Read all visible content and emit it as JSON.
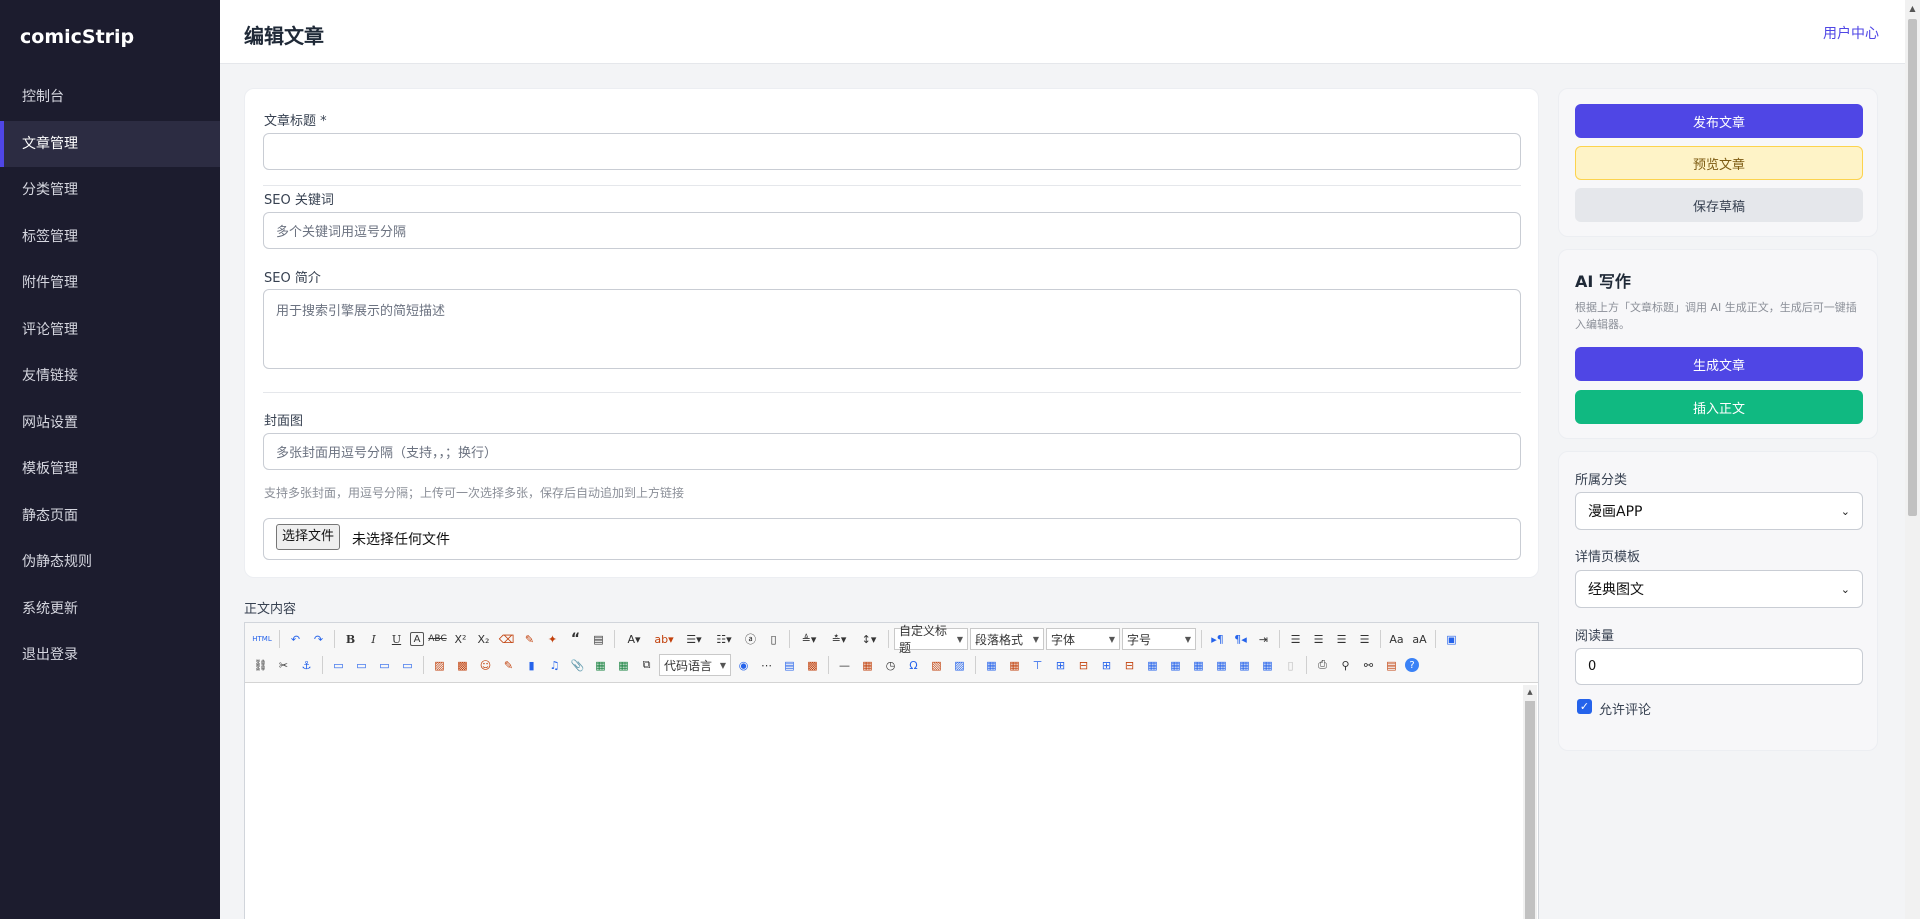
{
  "app": {
    "brand": "comicStrip"
  },
  "sidebar": {
    "items": [
      {
        "label": "控制台"
      },
      {
        "label": "文章管理",
        "active": true
      },
      {
        "label": "分类管理"
      },
      {
        "label": "标签管理"
      },
      {
        "label": "附件管理"
      },
      {
        "label": "评论管理"
      },
      {
        "label": "友情链接"
      },
      {
        "label": "网站设置"
      },
      {
        "label": "模板管理"
      },
      {
        "label": "静态页面"
      },
      {
        "label": "伪静态规则"
      },
      {
        "label": "系统更新"
      },
      {
        "label": "退出登录"
      }
    ]
  },
  "header": {
    "title": "编辑文章",
    "user_center": "用户中心"
  },
  "form": {
    "title_label": "文章标题 *",
    "title_value": "",
    "seo_keywords_label": "SEO 关键词",
    "seo_keywords_placeholder": "多个关键词用逗号分隔",
    "seo_desc_label": "SEO 简介",
    "seo_desc_placeholder": "用于搜索引擎展示的简短描述",
    "cover_label": "封面图",
    "cover_placeholder": "多张封面用逗号分隔（支持，，；换行）",
    "cover_hint": "支持多张封面，用逗号分隔；上传可一次选择多张，保存后自动追加到上方链接",
    "file_button": "选择文件",
    "file_status": "未选择任何文件"
  },
  "editor": {
    "label": "正文内容",
    "selects": {
      "custom_title": "自定义标题",
      "paragraph": "段落格式",
      "font": "字体",
      "size": "字号",
      "code_lang": "代码语言"
    }
  },
  "publish": {
    "publish_label": "发布文章",
    "preview_label": "预览文章",
    "draft_label": "保存草稿"
  },
  "ai": {
    "title": "AI 写作",
    "desc": "根据上方「文章标题」调用 AI 生成正文，生成后可一键插入编辑器。",
    "generate_label": "生成文章",
    "insert_label": "插入正文"
  },
  "meta": {
    "category_label": "所属分类",
    "category_value": "漫画APP",
    "template_label": "详情页模板",
    "template_value": "经典图文",
    "views_label": "阅读量",
    "views_value": "0",
    "allow_comments_label": "允许评论",
    "allow_comments": true
  },
  "colors": {
    "sidebar_bg": "#1c1c2e",
    "accent": "#4f46e5",
    "green": "#10b981",
    "warn_bg": "#fef3c7"
  }
}
